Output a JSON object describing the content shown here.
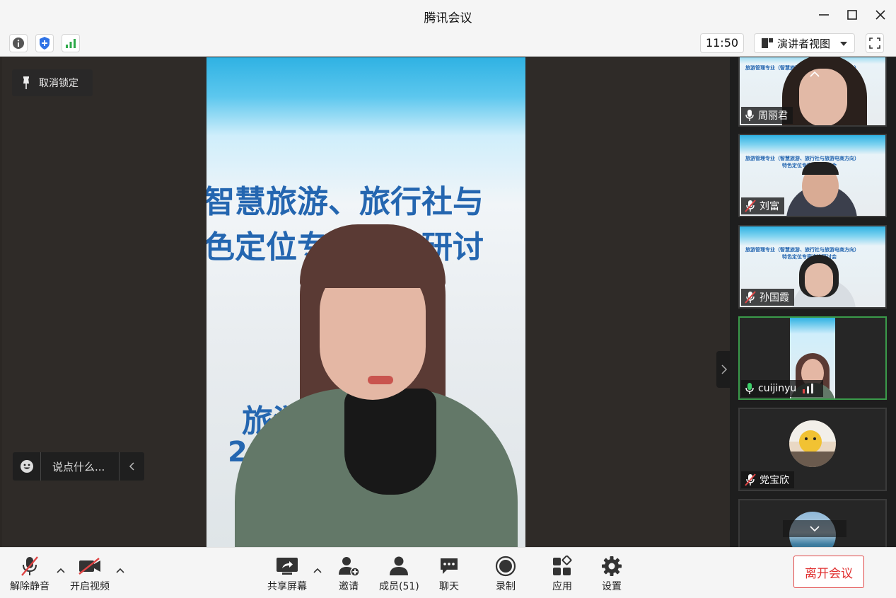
{
  "window": {
    "title": "腾讯会议"
  },
  "toolbar": {
    "time": "11:50",
    "view_label": "演讲者视图"
  },
  "stage": {
    "unpin_label": "取消锁定",
    "chat_placeholder": "说点什么...",
    "slide_line1": "智慧旅游、旅行社与",
    "slide_line2": "色定位专家咨询研讨",
    "slide_line3": "旅游",
    "slide_line4": "2"
  },
  "participants": [
    {
      "name": "周丽君",
      "mic": "on"
    },
    {
      "name": "刘富",
      "mic": "muted"
    },
    {
      "name": "孙国霞",
      "mic": "muted"
    },
    {
      "name": "cuijinyu",
      "mic": "speaking"
    },
    {
      "name": "党宝欣",
      "mic": "muted"
    }
  ],
  "tile_slide_text": {
    "line1": "旅游管理专业（智慧旅游、旅行社与旅游电商方向）",
    "line2": "特色定位专家咨询研讨会"
  },
  "bottom": {
    "unmute": "解除静音",
    "video": "开启视频",
    "share": "共享屏幕",
    "invite": "邀请",
    "members": "成员(51)",
    "chat": "聊天",
    "record": "录制",
    "apps": "应用",
    "settings": "设置",
    "leave": "离开会议"
  },
  "colors": {
    "accent_green": "#3a9a4a",
    "leave_red": "#e03030",
    "muted_red": "#e04545"
  }
}
